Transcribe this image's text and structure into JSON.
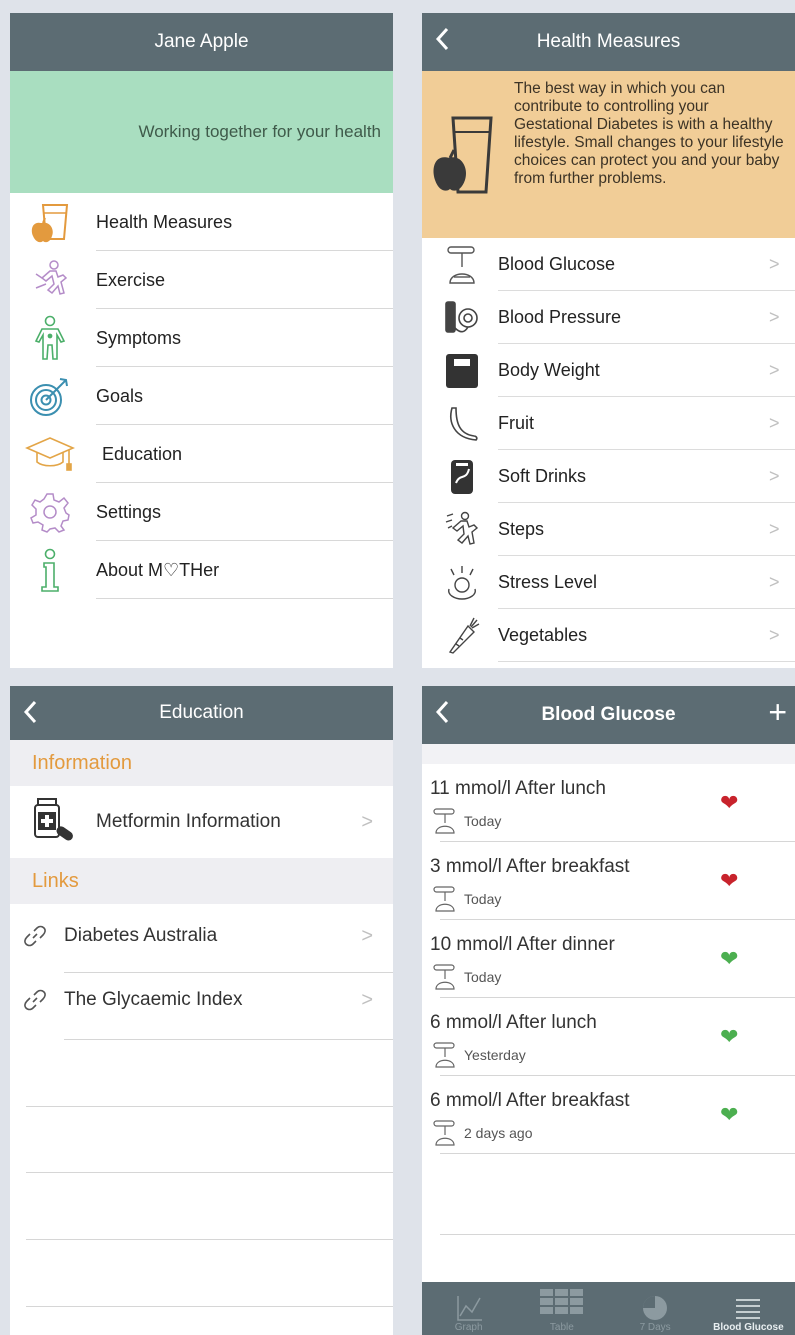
{
  "main_menu": {
    "title": "Jane Apple",
    "tagline": "Working together for your health",
    "items": [
      {
        "label": "Health Measures",
        "icon": "apple-glass-icon"
      },
      {
        "label": "Exercise",
        "icon": "running-person-icon"
      },
      {
        "label": "Symptoms",
        "icon": "person-body-icon"
      },
      {
        "label": "Goals",
        "icon": "target-icon"
      },
      {
        "label": "Education",
        "icon": "graduation-cap-icon"
      },
      {
        "label": "Settings",
        "icon": "gear-icon"
      },
      {
        "label": "About M♡THer",
        "icon": "info-icon"
      }
    ]
  },
  "health_measures": {
    "title": "Health Measures",
    "intro": "The best way in which you can contribute to controlling your Gestational Diabetes is with a healthy lifestyle. Small changes to your lifestyle choices can protect you and your baby from further problems.",
    "items": [
      {
        "label": "Blood Glucose",
        "icon": "glucose-meter-icon"
      },
      {
        "label": "Blood Pressure",
        "icon": "blood-pressure-icon"
      },
      {
        "label": "Body Weight",
        "icon": "scale-icon"
      },
      {
        "label": "Fruit",
        "icon": "banana-icon"
      },
      {
        "label": "Soft Drinks",
        "icon": "soda-can-icon"
      },
      {
        "label": "Steps",
        "icon": "steps-icon"
      },
      {
        "label": "Stress Level",
        "icon": "stress-icon"
      },
      {
        "label": "Vegetables",
        "icon": "carrot-icon"
      }
    ]
  },
  "education": {
    "title": "Education",
    "sections": {
      "information": "Information",
      "links": "Links"
    },
    "information_items": [
      {
        "label": "Metformin Information",
        "icon": "medicine-bottle-icon"
      }
    ],
    "link_items": [
      {
        "label": "Diabetes Australia",
        "icon": "link-icon"
      },
      {
        "label": "The Glycaemic Index",
        "icon": "link-icon"
      }
    ]
  },
  "blood_glucose": {
    "title": "Blood Glucose",
    "add_label": "+",
    "readings": [
      {
        "title": "11 mmol/l After lunch",
        "when": "Today",
        "status": "high"
      },
      {
        "title": "3 mmol/l After breakfast",
        "when": "Today",
        "status": "high"
      },
      {
        "title": "10 mmol/l After dinner",
        "when": "Today",
        "status": "ok"
      },
      {
        "title": "6 mmol/l After lunch",
        "when": "Yesterday",
        "status": "ok"
      },
      {
        "title": "6 mmol/l After breakfast",
        "when": "2 days ago",
        "status": "ok"
      }
    ],
    "tabs": [
      {
        "label": "Graph",
        "icon": "graph-icon"
      },
      {
        "label": "Table",
        "icon": "table-icon"
      },
      {
        "label": "7 Days",
        "icon": "pie-icon"
      },
      {
        "label": "Blood Glucose",
        "icon": "list-icon",
        "active": true
      }
    ]
  },
  "colors": {
    "navbar": "#5c6c73",
    "tagline_bg": "#a9dec0",
    "intro_bg": "#f1cd97",
    "section_header_text": "#e39a3e",
    "heart_high": "#c8232c",
    "heart_ok": "#4caf50"
  }
}
